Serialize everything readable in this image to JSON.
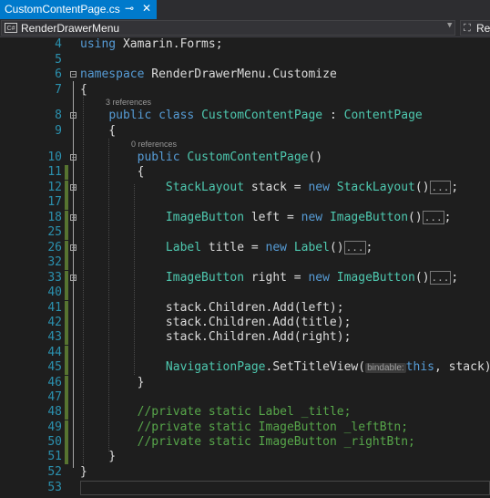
{
  "tab": {
    "title": "CustomContentPage.cs",
    "pin": "⊸",
    "close": "✕"
  },
  "navbar": {
    "class_icon": "C#",
    "class_name": "RenderDrawerMenu",
    "member_name": "Re"
  },
  "codelens": {
    "class_refs": "3 references",
    "ctor_refs": "0 references"
  },
  "lines": [
    {
      "n": "4",
      "code": [
        [
          "k",
          "using"
        ],
        [
          "p",
          " Xamarin.Forms;"
        ]
      ]
    },
    {
      "n": "5",
      "code": []
    },
    {
      "n": "6",
      "code": [
        [
          "k",
          "namespace"
        ],
        [
          "p",
          " RenderDrawerMenu.Customize"
        ]
      ]
    },
    {
      "n": "7",
      "code": [
        [
          "p",
          "{"
        ]
      ]
    },
    {
      "n": "8",
      "code": [
        [
          "p",
          "    "
        ],
        [
          "k",
          "public"
        ],
        [
          "p",
          " "
        ],
        [
          "k",
          "class"
        ],
        [
          "p",
          " "
        ],
        [
          "t",
          "CustomContentPage"
        ],
        [
          "p",
          " : "
        ],
        [
          "t",
          "ContentPage"
        ]
      ]
    },
    {
      "n": "9",
      "code": [
        [
          "p",
          "    {"
        ]
      ]
    },
    {
      "n": "10",
      "code": [
        [
          "p",
          "        "
        ],
        [
          "k",
          "public"
        ],
        [
          "p",
          " "
        ],
        [
          "t",
          "CustomContentPage"
        ],
        [
          "p",
          "()"
        ]
      ]
    },
    {
      "n": "11",
      "code": [
        [
          "p",
          "        {"
        ]
      ]
    },
    {
      "n": "12",
      "code": [
        [
          "p",
          "            "
        ],
        [
          "t",
          "StackLayout"
        ],
        [
          "p",
          " stack = "
        ],
        [
          "k",
          "new"
        ],
        [
          "p",
          " "
        ],
        [
          "t",
          "StackLayout"
        ],
        [
          "p",
          "()"
        ],
        [
          "e",
          "..."
        ],
        [
          "p",
          ";"
        ]
      ]
    },
    {
      "n": "17",
      "code": []
    },
    {
      "n": "18",
      "code": [
        [
          "p",
          "            "
        ],
        [
          "t",
          "ImageButton"
        ],
        [
          "p",
          " left = "
        ],
        [
          "k",
          "new"
        ],
        [
          "p",
          " "
        ],
        [
          "t",
          "ImageButton"
        ],
        [
          "p",
          "()"
        ],
        [
          "e",
          "..."
        ],
        [
          "p",
          ";"
        ]
      ]
    },
    {
      "n": "25",
      "code": []
    },
    {
      "n": "26",
      "code": [
        [
          "p",
          "            "
        ],
        [
          "t",
          "Label"
        ],
        [
          "p",
          " title = "
        ],
        [
          "k",
          "new"
        ],
        [
          "p",
          " "
        ],
        [
          "t",
          "Label"
        ],
        [
          "p",
          "()"
        ],
        [
          "e",
          "..."
        ],
        [
          "p",
          ";"
        ]
      ]
    },
    {
      "n": "32",
      "code": []
    },
    {
      "n": "33",
      "code": [
        [
          "p",
          "            "
        ],
        [
          "t",
          "ImageButton"
        ],
        [
          "p",
          " right = "
        ],
        [
          "k",
          "new"
        ],
        [
          "p",
          " "
        ],
        [
          "t",
          "ImageButton"
        ],
        [
          "p",
          "()"
        ],
        [
          "e",
          "..."
        ],
        [
          "p",
          ";"
        ]
      ]
    },
    {
      "n": "40",
      "code": []
    },
    {
      "n": "41",
      "code": [
        [
          "p",
          "            stack.Children.Add(left);"
        ]
      ]
    },
    {
      "n": "42",
      "code": [
        [
          "p",
          "            stack.Children.Add(title);"
        ]
      ]
    },
    {
      "n": "43",
      "code": [
        [
          "p",
          "            stack.Children.Add(right);"
        ]
      ]
    },
    {
      "n": "44",
      "code": []
    },
    {
      "n": "45",
      "code": [
        [
          "p",
          "            "
        ],
        [
          "t",
          "NavigationPage"
        ],
        [
          "p",
          ".SetTitleView("
        ],
        [
          "h",
          "bindable:"
        ],
        [
          "k",
          "this"
        ],
        [
          "p",
          ", stack);"
        ]
      ]
    },
    {
      "n": "46",
      "code": [
        [
          "p",
          "        }"
        ]
      ]
    },
    {
      "n": "47",
      "code": []
    },
    {
      "n": "48",
      "code": [
        [
          "p",
          "        "
        ],
        [
          "c",
          "//private static Label _title;"
        ]
      ]
    },
    {
      "n": "49",
      "code": [
        [
          "p",
          "        "
        ],
        [
          "c",
          "//private static ImageButton _leftBtn;"
        ]
      ]
    },
    {
      "n": "50",
      "code": [
        [
          "p",
          "        "
        ],
        [
          "c",
          "//private static ImageButton _rightBtn;"
        ]
      ]
    },
    {
      "n": "51",
      "code": [
        [
          "p",
          "    }"
        ]
      ]
    },
    {
      "n": "52",
      "code": [
        [
          "p",
          "}"
        ]
      ]
    },
    {
      "n": "53",
      "code": []
    }
  ],
  "colors": {
    "keyword": "#569cd6",
    "type": "#4ec9b0",
    "comment": "#57a64a",
    "line_number": "#2b91af",
    "change_bar": "#577430",
    "tab_active": "#007acc"
  }
}
